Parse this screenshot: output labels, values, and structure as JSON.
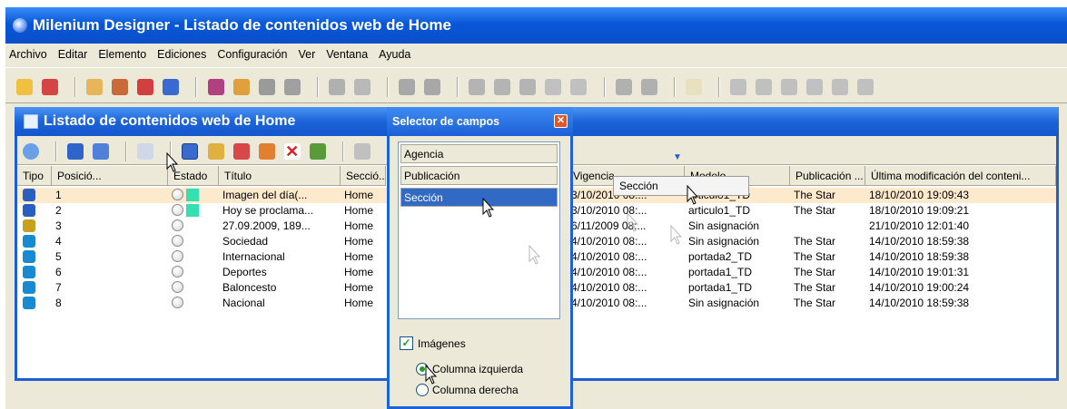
{
  "window": {
    "title": "Milenium Designer - Listado de contenidos web de Home"
  },
  "menu": [
    "Archivo",
    "Editar",
    "Elemento",
    "Ediciones",
    "Configuración",
    "Ver",
    "Ventana",
    "Ayuda"
  ],
  "inner_window": {
    "title": "Listado de contenidos web de Home"
  },
  "columns": [
    "Tipo",
    "Posició...",
    "Estado",
    "Título",
    "Secció...",
    "Vigencia",
    "Modelo",
    "Publicación ...",
    "Última modificación del conteni..."
  ],
  "rows": [
    {
      "pos": "1",
      "titulo": "Imagen del día(...",
      "seccion": "Home",
      "vigencia": "3/10/2010 08:...",
      "modelo": "articulo1_TD",
      "publicacion": "The Star",
      "modificacion": "18/10/2010 19:09:43",
      "type_icon": "globe-icon",
      "green": true
    },
    {
      "pos": "2",
      "titulo": "Hoy se proclama...",
      "seccion": "Home",
      "vigencia": "3/10/2010 08:...",
      "modelo": "articulo1_TD",
      "publicacion": "The Star",
      "modificacion": "18/10/2010 19:09:21",
      "type_icon": "globe-icon",
      "green": true
    },
    {
      "pos": "3",
      "titulo": "27.09.2009, 189...",
      "seccion": "Home",
      "vigencia": "6/11/2009 08:...",
      "modelo": "Sin asignación",
      "publicacion": "",
      "modificacion": "21/10/2010 12:01:40",
      "type_icon": "pencil-icon",
      "green": false
    },
    {
      "pos": "4",
      "titulo": "Sociedad",
      "seccion": "Home",
      "vigencia": "4/10/2010 08:...",
      "modelo": "Sin asignación",
      "publicacion": "The Star",
      "modificacion": "14/10/2010 18:59:38",
      "type_icon": "page-icon",
      "green": false
    },
    {
      "pos": "5",
      "titulo": "Internacional",
      "seccion": "Home",
      "vigencia": "4/10/2010 08:...",
      "modelo": "portada2_TD",
      "publicacion": "The Star",
      "modificacion": "14/10/2010 18:59:38",
      "type_icon": "page-icon",
      "green": false
    },
    {
      "pos": "6",
      "titulo": "Deportes",
      "seccion": "Home",
      "vigencia": "4/10/2010 08:...",
      "modelo": "portada1_TD",
      "publicacion": "The Star",
      "modificacion": "14/10/2010 19:01:31",
      "type_icon": "page-icon",
      "green": false
    },
    {
      "pos": "7",
      "titulo": "Baloncesto",
      "seccion": "Home",
      "vigencia": "4/10/2010 08:...",
      "modelo": "portada1_TD",
      "publicacion": "The Star",
      "modificacion": "14/10/2010 19:00:24",
      "type_icon": "page-icon",
      "green": false
    },
    {
      "pos": "8",
      "titulo": "Nacional",
      "seccion": "Home",
      "vigencia": "4/10/2010 08:...",
      "modelo": "Sin asignación",
      "publicacion": "The Star",
      "modificacion": "14/10/2010 18:59:38",
      "type_icon": "page-icon",
      "green": false
    }
  ],
  "selector": {
    "title": "Selector de campos",
    "fields": [
      "Agencia",
      "Publicación",
      "Sección"
    ],
    "selected_field": "Sección",
    "images_label": "Imágenes",
    "images_checked": true,
    "options": [
      "Columna izquierda",
      "Columna derecha"
    ],
    "selected_option": "Columna izquierda"
  },
  "drag_tooltip": "Sección"
}
